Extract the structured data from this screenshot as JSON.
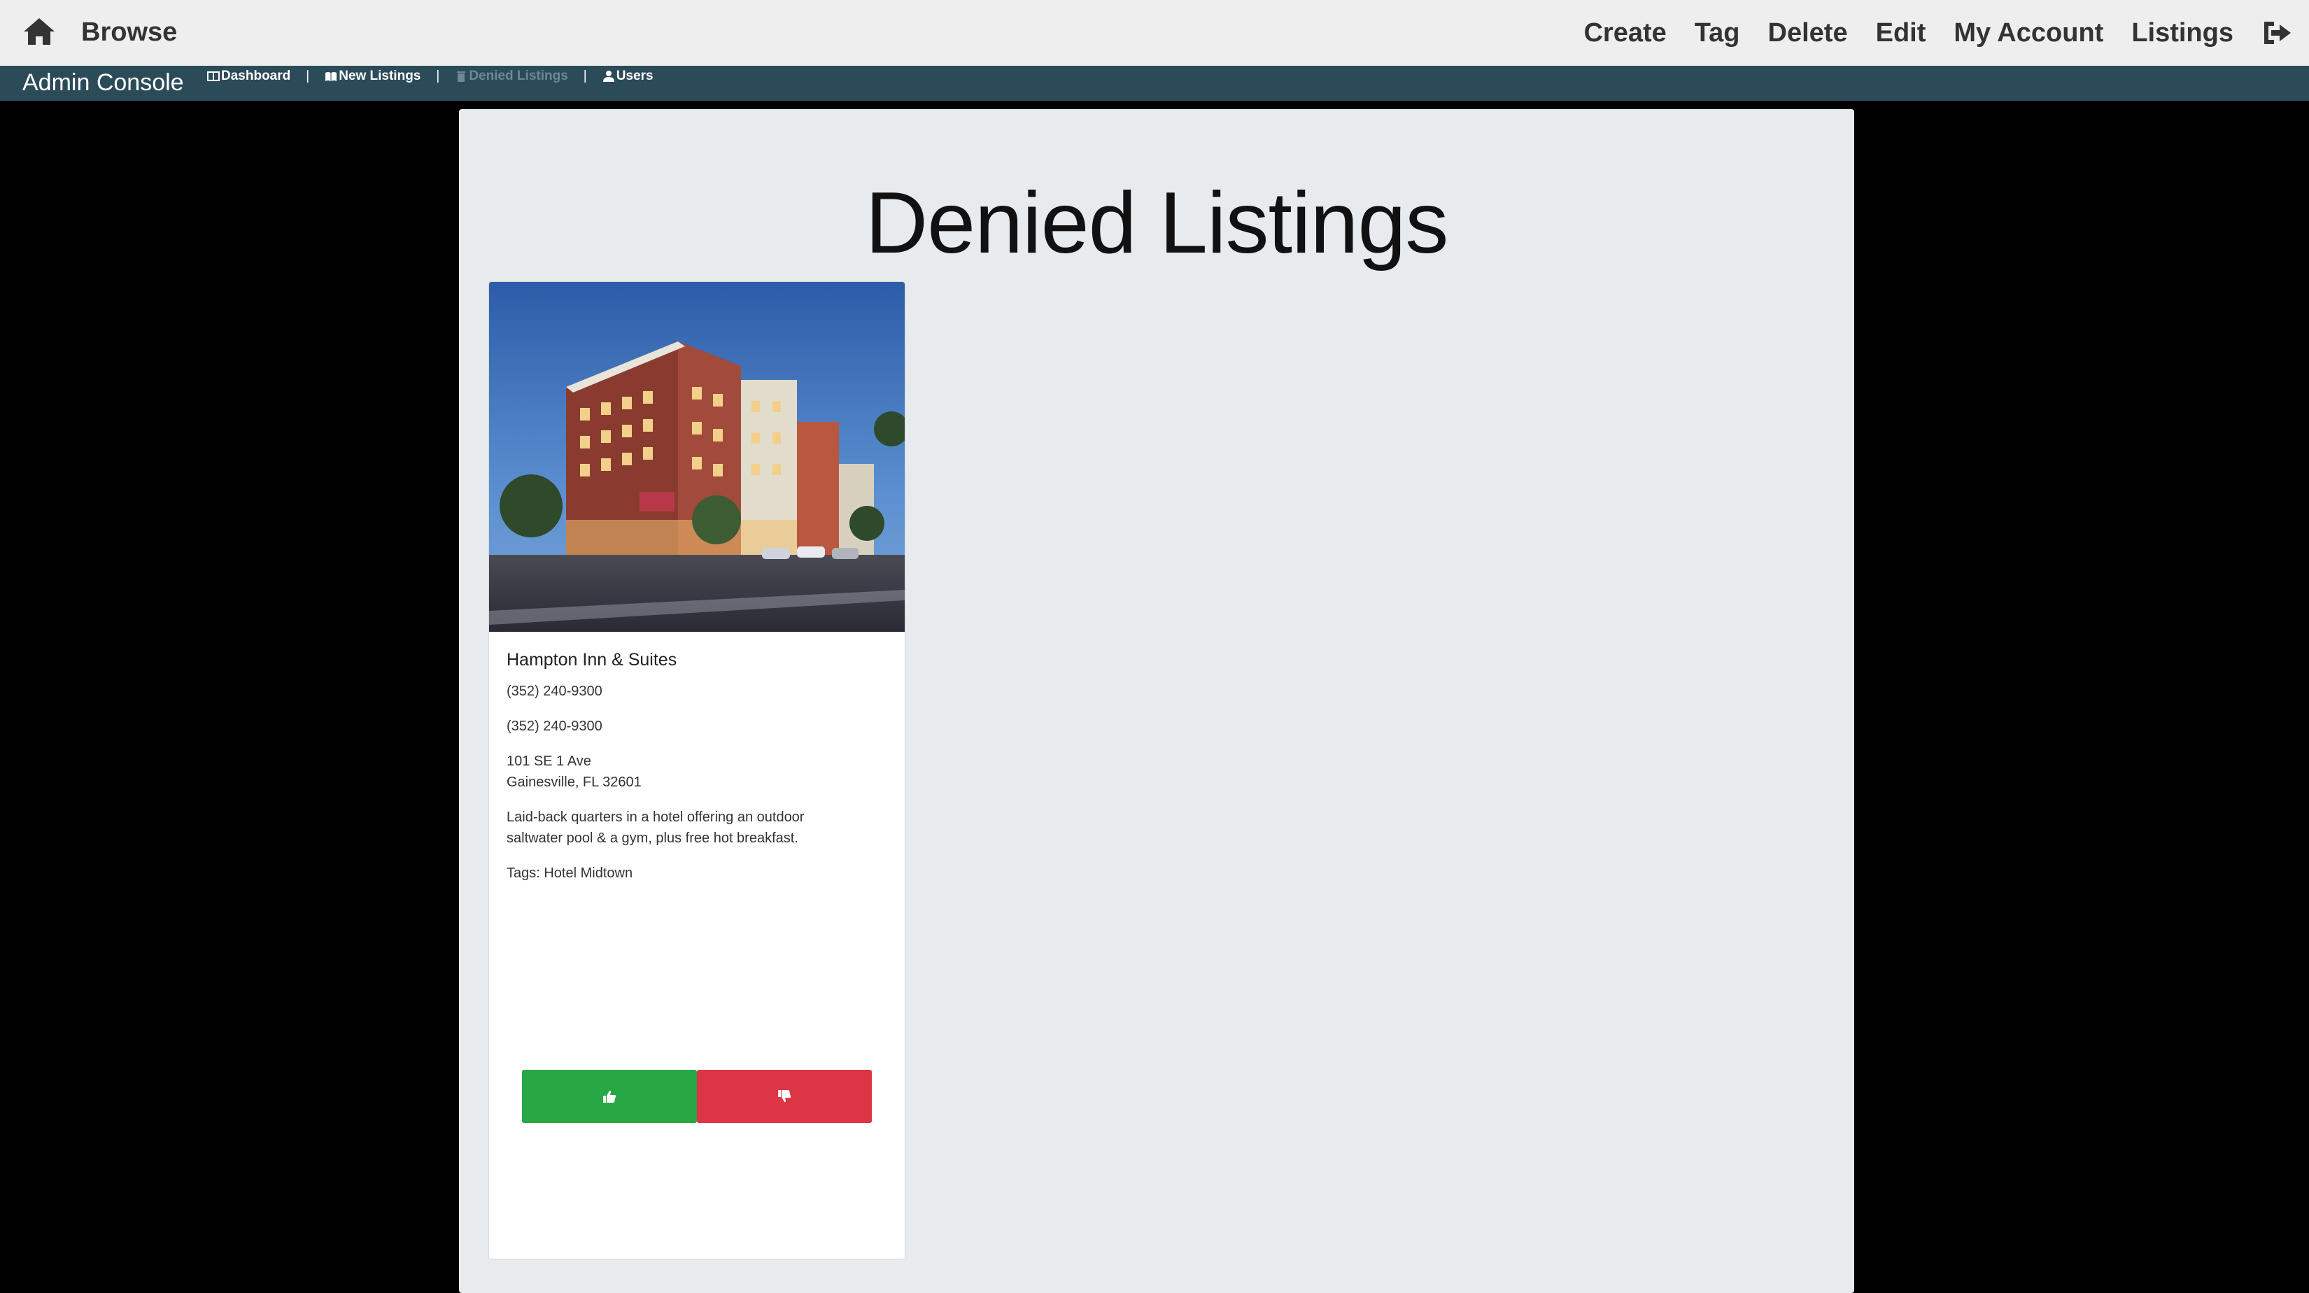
{
  "topbar": {
    "brand": "Browse",
    "nav": [
      "Create",
      "Tag",
      "Delete",
      "Edit",
      "My Account",
      "Listings"
    ]
  },
  "adminbar": {
    "title": "Admin Console",
    "links": [
      {
        "label": "Dashboard",
        "icon": "columns-icon"
      },
      {
        "label": "New Listings",
        "icon": "book-open-icon"
      },
      {
        "label": "Denied Listings",
        "icon": "trash-icon",
        "active": true
      },
      {
        "label": "Users",
        "icon": "user-icon"
      }
    ],
    "separator": "|"
  },
  "page": {
    "title": "Denied Listings"
  },
  "listing": {
    "name": "Hampton Inn & Suites",
    "phone1": "(352) 240-9300",
    "phone2": "(352) 240-9300",
    "address_line1": "101 SE 1 Ave",
    "address_line2": "Gainesville, FL 32601",
    "description_line1": "Laid-back quarters in a hotel offering an outdoor",
    "description_line2": "saltwater pool & a gym, plus free hot breakfast.",
    "tags": "Tags: Hotel Midtown",
    "image_sign": "Hampton Inn & Suites",
    "approve_icon": "thumbs-up-icon",
    "deny_icon": "thumbs-down-icon"
  },
  "colors": {
    "topbar_bg": "#eeeeee",
    "adminbar_bg": "#2b4b59",
    "panel_bg": "#e8ebee",
    "approve": "#28a745",
    "deny": "#dc3545"
  }
}
